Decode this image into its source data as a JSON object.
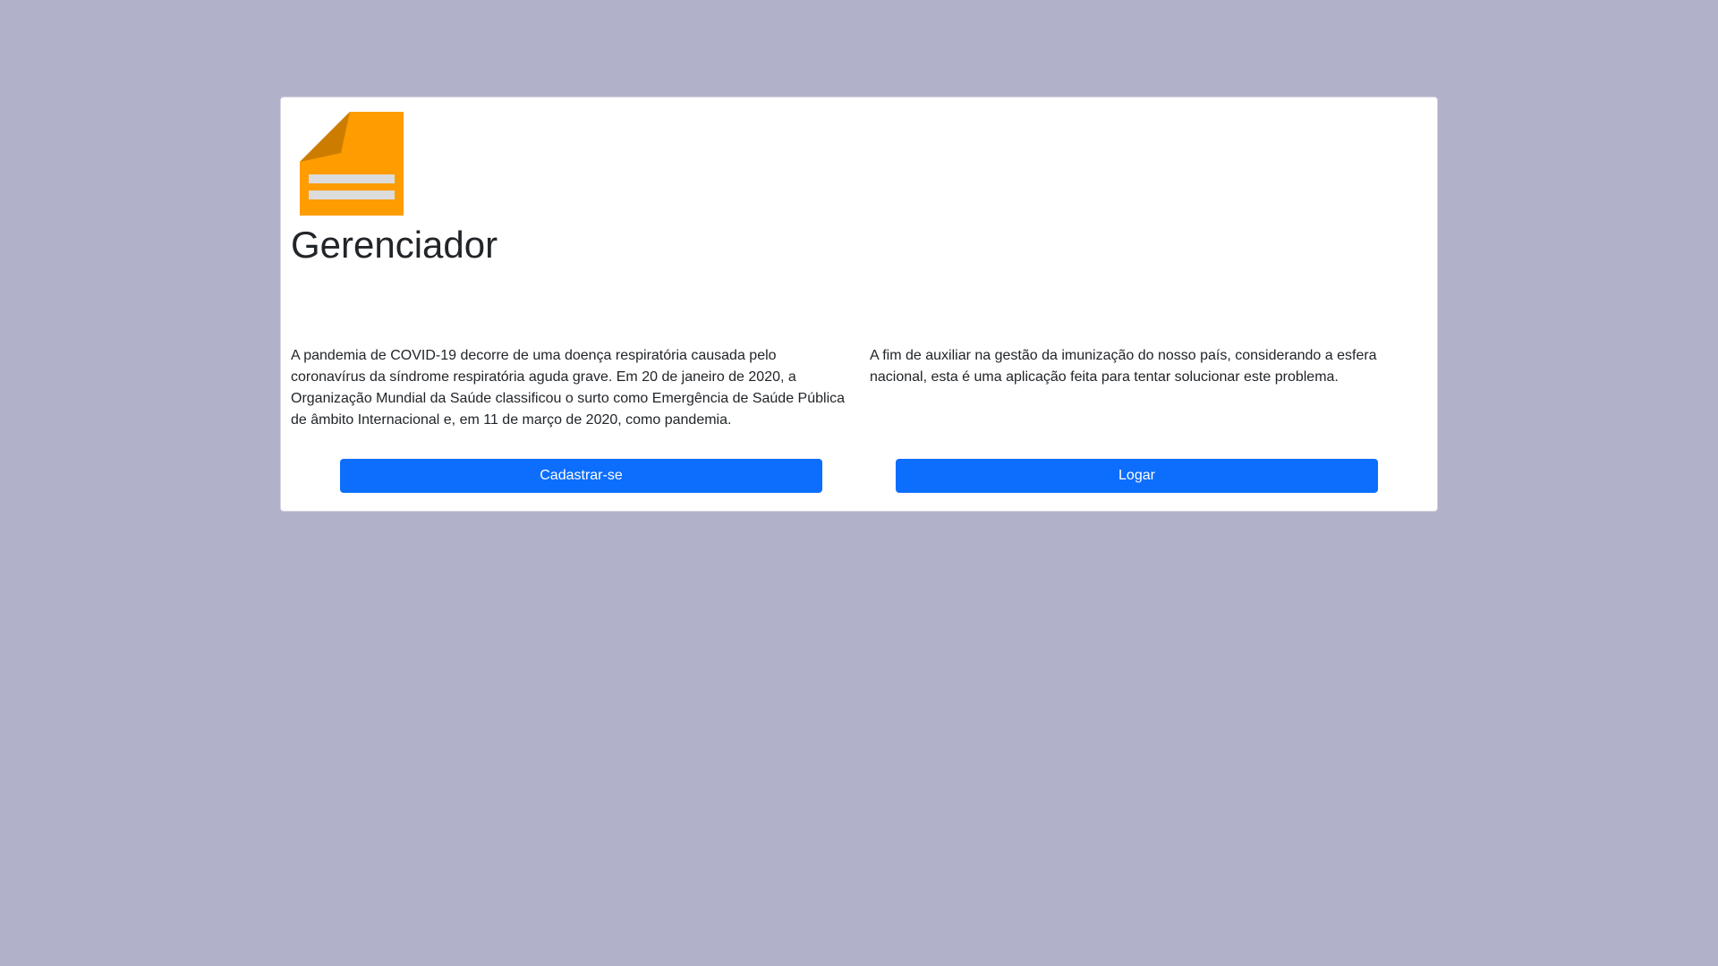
{
  "brand": {
    "logo_icon": "document-icon",
    "logo_color": "#ff9c00",
    "logo_fold_color": "#cc7d00",
    "logo_line_color": "#dcdcdc",
    "title": "Gerenciador"
  },
  "content": {
    "left_paragraph": "A pandemia de COVID-19 decorre de uma doença respiratória causada pelo coronavírus da síndrome respiratória aguda grave. Em 20 de janeiro de 2020, a Organização Mundial da Saúde classificou o surto como Emergência de Saúde Pública de âmbito Internacional e, em 11 de março de 2020, como pandemia.",
    "right_paragraph": "A fim de auxiliar na gestão da imunização do nosso país, considerando a esfera nacional, esta é uma aplicação feita para tentar solucionar este problema."
  },
  "actions": {
    "register_label": "Cadastrar-se",
    "login_label": "Logar",
    "button_color": "#0d6efd"
  },
  "colors": {
    "background": "#b1b1ca",
    "card": "#ffffff"
  }
}
